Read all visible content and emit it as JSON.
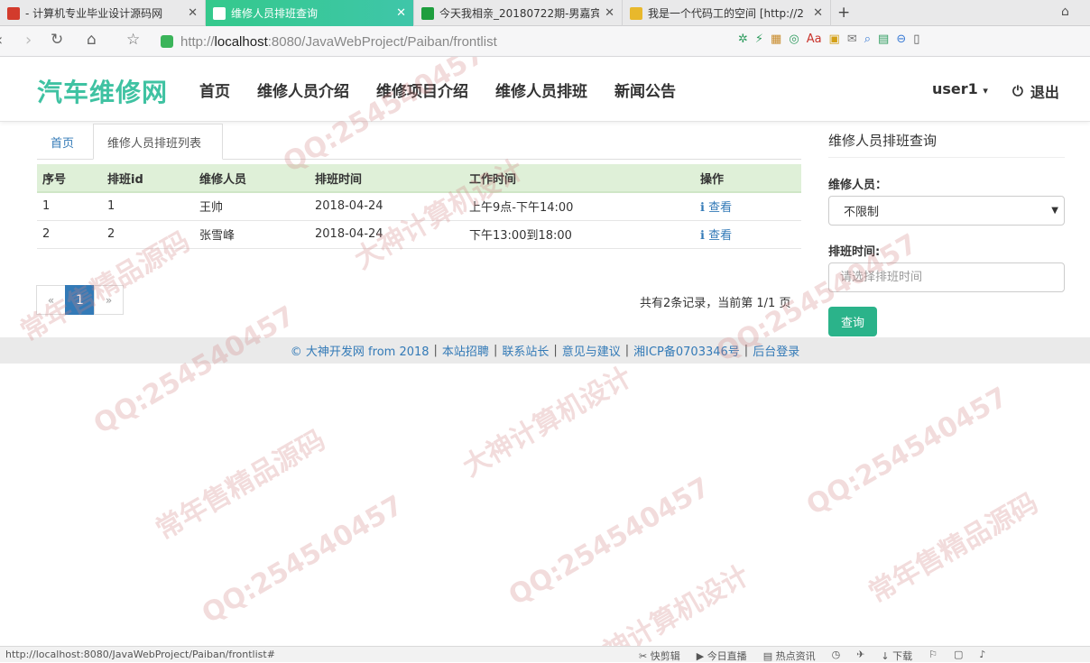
{
  "browser": {
    "tabs": [
      {
        "title": "- 计算机专业毕业设计源码网",
        "color": "#d33b2c",
        "active": false
      },
      {
        "title": "维修人员排班查询",
        "color": "#ffffff",
        "active": true
      },
      {
        "title": "今天我相亲_20180722期-男嘉宾",
        "color": "#1e9e3e",
        "active": false
      },
      {
        "title": "我是一个代码工的空间 [http://2",
        "color": "#e8b82c",
        "active": false
      }
    ],
    "url_prefix": "http://",
    "url_host": "localhost",
    "url_path": ":8080/JavaWebProject/Paiban/frontlist"
  },
  "header": {
    "logo": "汽车维修网",
    "nav": [
      "首页",
      "维修人员介绍",
      "维修项目介绍",
      "维修人员排班",
      "新闻公告"
    ],
    "user": "user1",
    "user_caret": "▾",
    "logout": "退出"
  },
  "subtabs": {
    "home": "首页",
    "current": "维修人员排班列表"
  },
  "table": {
    "columns": [
      "序号",
      "排班id",
      "维修人员",
      "排班时间",
      "工作时间",
      "操作"
    ],
    "rows": [
      {
        "no": "1",
        "id": "1",
        "person": "王帅",
        "date": "2018-04-24",
        "work": "上午9点-下午14:00",
        "action": "查看"
      },
      {
        "no": "2",
        "id": "2",
        "person": "张雪峰",
        "date": "2018-04-24",
        "work": "下午13:00到18:00",
        "action": "查看"
      }
    ]
  },
  "pagination": {
    "prev": "«",
    "current": "1",
    "next": "»",
    "info": "共有2条记录，当前第 1/1 页"
  },
  "query": {
    "title": "维修人员排班查询",
    "person_label": "维修人员：",
    "person_value": "不限制",
    "date_label": "排班时间:",
    "date_placeholder": "请选择排班时间",
    "submit": "查询"
  },
  "footer": {
    "links": [
      "© 大神开发网 from 2018",
      "本站招聘",
      "联系站长",
      "意见与建议",
      "湘ICP备0703346号",
      "后台登录"
    ]
  },
  "statusbar": {
    "url": "http://localhost:8080/JavaWebProject/Paiban/frontlist#",
    "items": [
      "快剪辑",
      "今日直播",
      "热点资讯",
      "下载"
    ]
  },
  "watermark": {
    "lines": [
      "QQ:254540457",
      "大神计算机设计",
      "常年售精品源码"
    ]
  }
}
